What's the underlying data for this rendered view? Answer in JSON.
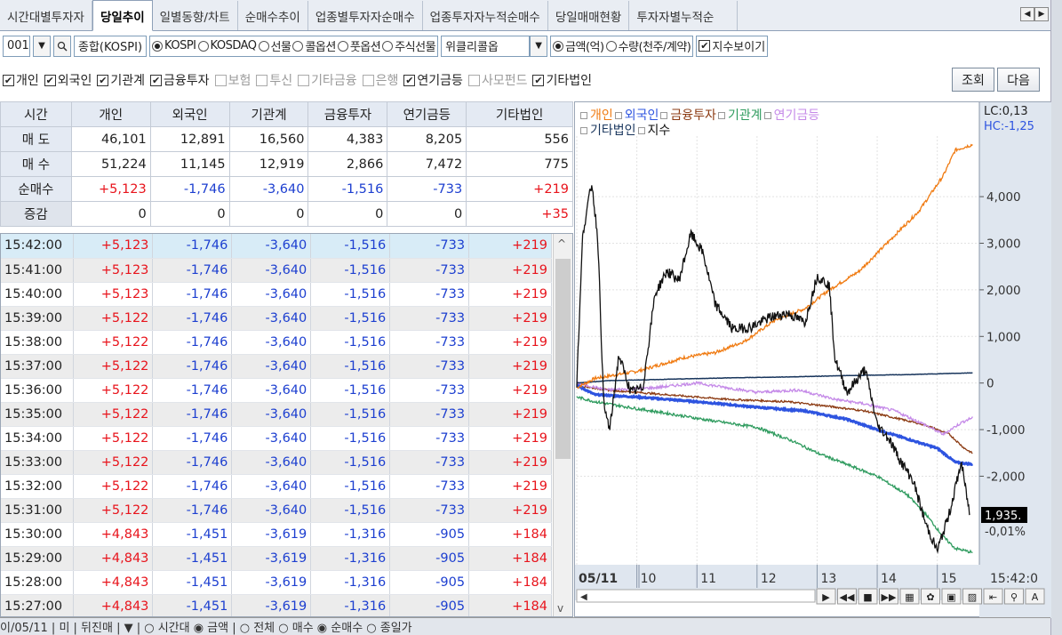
{
  "tabs": [
    "시간대별투자자",
    "당일추이",
    "일별동향/차트",
    "순매수추이",
    "업종별투자자순매수",
    "업종투자자누적순매수",
    "당일매매현황",
    "투자자별누적순"
  ],
  "active_tab": 1,
  "controls": {
    "code": "001",
    "market_name": "종합(KOSPI)",
    "radios_market": [
      {
        "label": "KOSPI",
        "on": true
      },
      {
        "label": "KOSDAQ",
        "on": false
      },
      {
        "label": "선물",
        "on": false
      },
      {
        "label": "콜옵션",
        "on": false
      },
      {
        "label": "풋옵션",
        "on": false
      },
      {
        "label": "주식선물",
        "on": false
      }
    ],
    "select_value": "위클리콜옵",
    "radios_unit": [
      {
        "label": "금액(억)",
        "on": true
      },
      {
        "label": "수량(천주/계약)",
        "on": false
      }
    ],
    "index_toggle": "지수보이기"
  },
  "filters": [
    {
      "label": "개인",
      "on": true
    },
    {
      "label": "외국인",
      "on": true
    },
    {
      "label": "기관계",
      "on": true
    },
    {
      "label": "금융투자",
      "on": true
    },
    {
      "label": "보험",
      "on": false
    },
    {
      "label": "투신",
      "on": false
    },
    {
      "label": "기타금융",
      "on": false
    },
    {
      "label": "은행",
      "on": false
    },
    {
      "label": "연기금등",
      "on": true
    },
    {
      "label": "사모펀드",
      "on": false
    },
    {
      "label": "기타법인",
      "on": true
    }
  ],
  "buttons": {
    "search": "조회",
    "next": "다음"
  },
  "summary": {
    "headers": [
      "시간",
      "개인",
      "외국인",
      "기관계",
      "금융투자",
      "연기금등",
      "기타법인"
    ],
    "rows": [
      {
        "label": "매 도",
        "values": [
          "46,101",
          "12,891",
          "16,560",
          "4,383",
          "8,205",
          "556"
        ],
        "colors": [
          "",
          "",
          "",
          "",
          "",
          ""
        ]
      },
      {
        "label": "매 수",
        "values": [
          "51,224",
          "11,145",
          "12,919",
          "2,866",
          "7,472",
          "775"
        ],
        "colors": [
          "",
          "",
          "",
          "",
          "",
          ""
        ]
      },
      {
        "label": "순매수",
        "values": [
          "+5,123",
          "-1,746",
          "-3,640",
          "-1,516",
          "-733",
          "+219"
        ],
        "colors": [
          "red",
          "blue",
          "blue",
          "blue",
          "blue",
          "red"
        ]
      },
      {
        "label": "증감",
        "values": [
          "0",
          "0",
          "0",
          "0",
          "0",
          "+35"
        ],
        "colors": [
          "",
          "",
          "",
          "",
          "",
          "red"
        ]
      }
    ]
  },
  "rows": [
    {
      "t": "15:42:00",
      "v": [
        "+5,123",
        "-1,746",
        "-3,640",
        "-1,516",
        "-733",
        "+219"
      ]
    },
    {
      "t": "15:41:00",
      "v": [
        "+5,123",
        "-1,746",
        "-3,640",
        "-1,516",
        "-733",
        "+219"
      ]
    },
    {
      "t": "15:40:00",
      "v": [
        "+5,123",
        "-1,746",
        "-3,640",
        "-1,516",
        "-733",
        "+219"
      ]
    },
    {
      "t": "15:39:00",
      "v": [
        "+5,122",
        "-1,746",
        "-3,640",
        "-1,516",
        "-733",
        "+219"
      ]
    },
    {
      "t": "15:38:00",
      "v": [
        "+5,122",
        "-1,746",
        "-3,640",
        "-1,516",
        "-733",
        "+219"
      ]
    },
    {
      "t": "15:37:00",
      "v": [
        "+5,122",
        "-1,746",
        "-3,640",
        "-1,516",
        "-733",
        "+219"
      ]
    },
    {
      "t": "15:36:00",
      "v": [
        "+5,122",
        "-1,746",
        "-3,640",
        "-1,516",
        "-733",
        "+219"
      ]
    },
    {
      "t": "15:35:00",
      "v": [
        "+5,122",
        "-1,746",
        "-3,640",
        "-1,516",
        "-733",
        "+219"
      ]
    },
    {
      "t": "15:34:00",
      "v": [
        "+5,122",
        "-1,746",
        "-3,640",
        "-1,516",
        "-733",
        "+219"
      ]
    },
    {
      "t": "15:33:00",
      "v": [
        "+5,122",
        "-1,746",
        "-3,640",
        "-1,516",
        "-733",
        "+219"
      ]
    },
    {
      "t": "15:32:00",
      "v": [
        "+5,122",
        "-1,746",
        "-3,640",
        "-1,516",
        "-733",
        "+219"
      ]
    },
    {
      "t": "15:31:00",
      "v": [
        "+5,122",
        "-1,746",
        "-3,640",
        "-1,516",
        "-733",
        "+219"
      ]
    },
    {
      "t": "15:30:00",
      "v": [
        "+4,843",
        "-1,451",
        "-3,619",
        "-1,316",
        "-905",
        "+184"
      ]
    },
    {
      "t": "15:29:00",
      "v": [
        "+4,843",
        "-1,451",
        "-3,619",
        "-1,316",
        "-905",
        "+184"
      ]
    },
    {
      "t": "15:28:00",
      "v": [
        "+4,843",
        "-1,451",
        "-3,619",
        "-1,316",
        "-905",
        "+184"
      ]
    },
    {
      "t": "15:27:00",
      "v": [
        "+4,843",
        "-1,451",
        "-3,619",
        "-1,316",
        "-905",
        "+184"
      ]
    }
  ],
  "chart": {
    "legend_row1": [
      {
        "name": "개인",
        "color": "#f07b12"
      },
      {
        "name": "외국인",
        "color": "#2e54e0"
      },
      {
        "name": "금융투자",
        "color": "#8b3a12"
      },
      {
        "name": "기관계",
        "color": "#2e9b5e"
      },
      {
        "name": "연기금등",
        "color": "#c58ae8"
      }
    ],
    "legend_row2": [
      {
        "name": "기타법인",
        "color": "#18355c"
      },
      {
        "name": "지수",
        "color": "#111111"
      }
    ],
    "lc": "LC:0,13",
    "hc": "HC:-1,25",
    "y_ticks": [
      "4,000",
      "3,000",
      "2,000",
      "1,000",
      "0",
      "-1,000",
      "-2,000"
    ],
    "y_values": [
      4000,
      3000,
      2000,
      1000,
      0,
      -1000,
      -2000
    ],
    "x_ticks": [
      "05/11",
      "10",
      "11",
      "12",
      "13",
      "14",
      "15"
    ],
    "time_label": "15:42:0",
    "last_value": "1,935.",
    "last_pct": "-0,01%",
    "y_range": [
      -3900,
      5300
    ],
    "x_range": [
      9,
      15.7
    ]
  },
  "bottom_bar": "  이/05/11          | 미 | 뒤진매   |  ▼ |  ○ 시간대     ◉ 금액       |  ○ 전체       ○ 매수      ◉ 순매수      ○ 종일가"
}
